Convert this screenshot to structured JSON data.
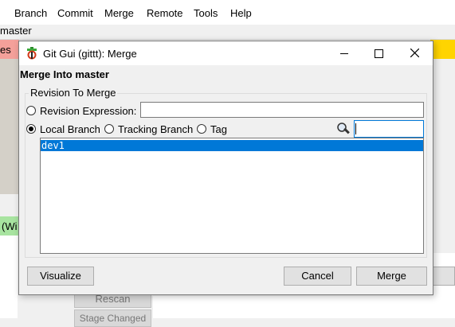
{
  "menu": [
    "",
    "Branch",
    "Commit",
    "Merge",
    "Remote",
    "Tools",
    "Help"
  ],
  "background": {
    "branch_label": "master",
    "unstaged_label": "es",
    "staged_label": "(Wi",
    "rescan_label": "Rescan",
    "stage_label": "Stage Changed"
  },
  "dialog": {
    "title": "Git Gui (gittt): Merge",
    "heading": "Merge Into master",
    "group_label": "Revision To Merge",
    "revision_expression_label": "Revision Expression:",
    "revision_expression_value": "",
    "local_branch_label": "Local Branch",
    "tracking_branch_label": "Tracking Branch",
    "tag_label": "Tag",
    "filter_value": "",
    "branches": [
      "dev1"
    ],
    "selected_branch": "dev1",
    "buttons": {
      "visualize": "Visualize",
      "cancel": "Cancel",
      "merge": "Merge"
    }
  },
  "colors": {
    "selection": "#0078d7",
    "unstaged_bg": "#f4a09a",
    "staged_bg": "#a8e4a0",
    "diff_header": "#ffd400"
  }
}
